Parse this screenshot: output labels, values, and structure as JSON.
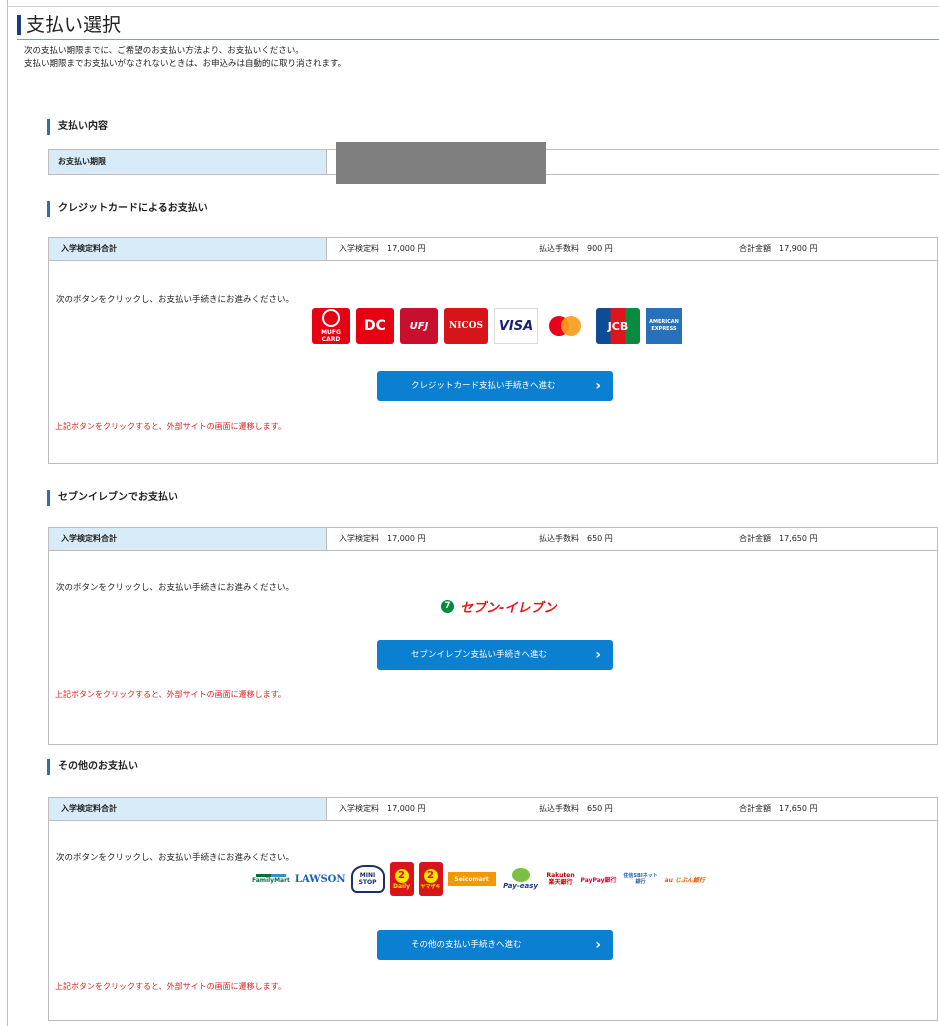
{
  "page": {
    "title": "支払い選択",
    "intro_line1": "次の支払い期限までに、ご希望のお支払い方法より、お支払いください。",
    "intro_line2": "支払い期限までお支払いがなされないときは、お申込みは自動的に取り消されます。"
  },
  "payment_details": {
    "heading": "支払い内容",
    "deadline_label": "お支払い期限",
    "deadline_value": ""
  },
  "credit": {
    "heading": "クレジットカードによるお支払い",
    "summary_label": "入学検定料合計",
    "exam_fee": "入学検定料　17,000 円",
    "handling_fee": "払込手数料　900 円",
    "total": "合計金額　17,900 円",
    "instruction": "次のボタンをクリックし、お支払い手続きにお進みください。",
    "button_label": "クレジットカード支払い手続きへ進む",
    "notice": "上記ボタンをクリックすると、外部サイトの画面に遷移します。",
    "logos": {
      "mufg": "MUFG\nCARD",
      "dc": "DC",
      "ufj": "UFJ",
      "nicos": "NICOS",
      "visa": "VISA",
      "jcb": "JCB",
      "amex": "AMERICAN\nEXPRESS"
    }
  },
  "seven": {
    "heading": "セブンイレブンでお支払い",
    "summary_label": "入学検定料合計",
    "exam_fee": "入学検定料　17,000 円",
    "handling_fee": "払込手数料　650 円",
    "total": "合計金額　17,650 円",
    "instruction": "次のボタンをクリックし、お支払い手続きにお進みください。",
    "logo_text": "セブン-イレブン",
    "button_label": "セブンイレブン支払い手続きへ進む",
    "notice": "上記ボタンをクリックすると、外部サイトの画面に遷移します。"
  },
  "other": {
    "heading": "その他のお支払い",
    "summary_label": "入学検定料合計",
    "exam_fee": "入学検定料　17,000 円",
    "handling_fee": "払込手数料　650 円",
    "total": "合計金額　17,650 円",
    "instruction": "次のボタンをクリックし、お支払い手続きにお進みください。",
    "logos": {
      "familymart": "FamilyMart",
      "lawson": "LAWSON",
      "ministop": "MINI STOP",
      "daily": "Daily",
      "yamazaki": "ヤマザキ",
      "seicomart": "Seicomart",
      "payeasy": "Pay-easy",
      "rakuten": "Rakuten 楽天銀行",
      "paypay": "PayPay銀行",
      "sbi": "住信SBIネット銀行",
      "au": "au じぶん銀行"
    },
    "button_label": "その他の支払い手続きへ進む",
    "notice": "上記ボタンをクリックすると、外部サイトの画面に遷移します。"
  },
  "colors": {
    "button": "#0b7fd0",
    "header_cell": "#d8ebf8",
    "warning": "#e02020",
    "heading_bar": "#2f6ea8"
  }
}
